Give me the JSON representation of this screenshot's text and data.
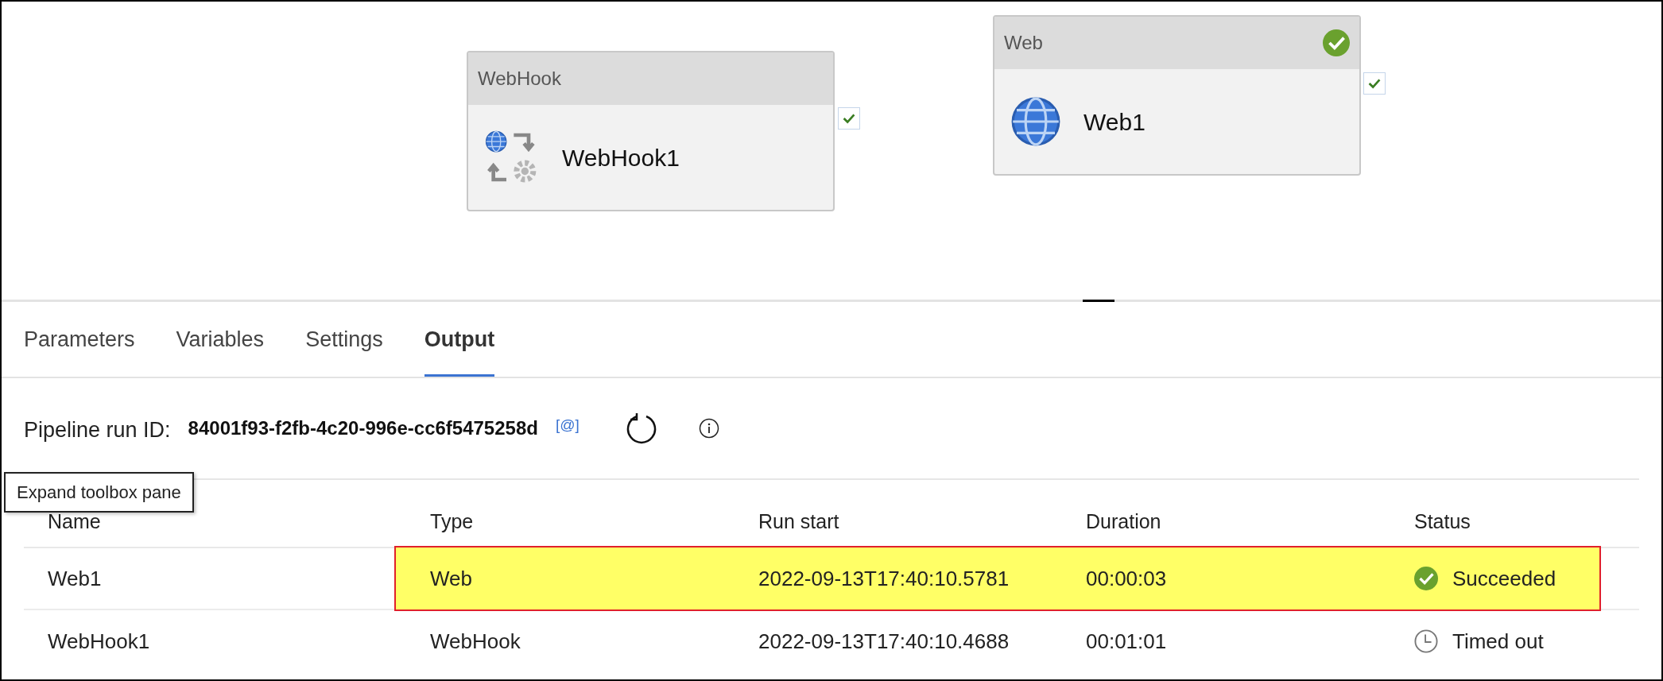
{
  "canvas": {
    "nodes": [
      {
        "kind": "webhook",
        "type_label": "WebHook",
        "name": "WebHook1",
        "succeeded": false
      },
      {
        "kind": "web",
        "type_label": "Web",
        "name": "Web1",
        "succeeded": true
      }
    ]
  },
  "tabs": [
    {
      "label": "Parameters",
      "selected": false
    },
    {
      "label": "Variables",
      "selected": false
    },
    {
      "label": "Settings",
      "selected": false
    },
    {
      "label": "Output",
      "selected": true
    }
  ],
  "pipeline_run": {
    "label": "Pipeline run ID:",
    "id": "84001f93-f2fb-4c20-996e-cc6f5475258d",
    "copy_link": "[@]"
  },
  "tooltip": "Expand toolbox pane",
  "table": {
    "columns": [
      "Name",
      "Type",
      "Run start",
      "Duration",
      "Status"
    ],
    "rows": [
      {
        "name": "Web1",
        "type": "Web",
        "run_start": "2022-09-13T17:40:10.5781",
        "duration": "00:00:03",
        "status": "Succeeded",
        "kind": "succeeded",
        "highlighted": true
      },
      {
        "name": "WebHook1",
        "type": "WebHook",
        "run_start": "2022-09-13T17:40:10.4688",
        "duration": "00:01:01",
        "status": "Timed out",
        "kind": "timed_out",
        "highlighted": false
      }
    ]
  }
}
